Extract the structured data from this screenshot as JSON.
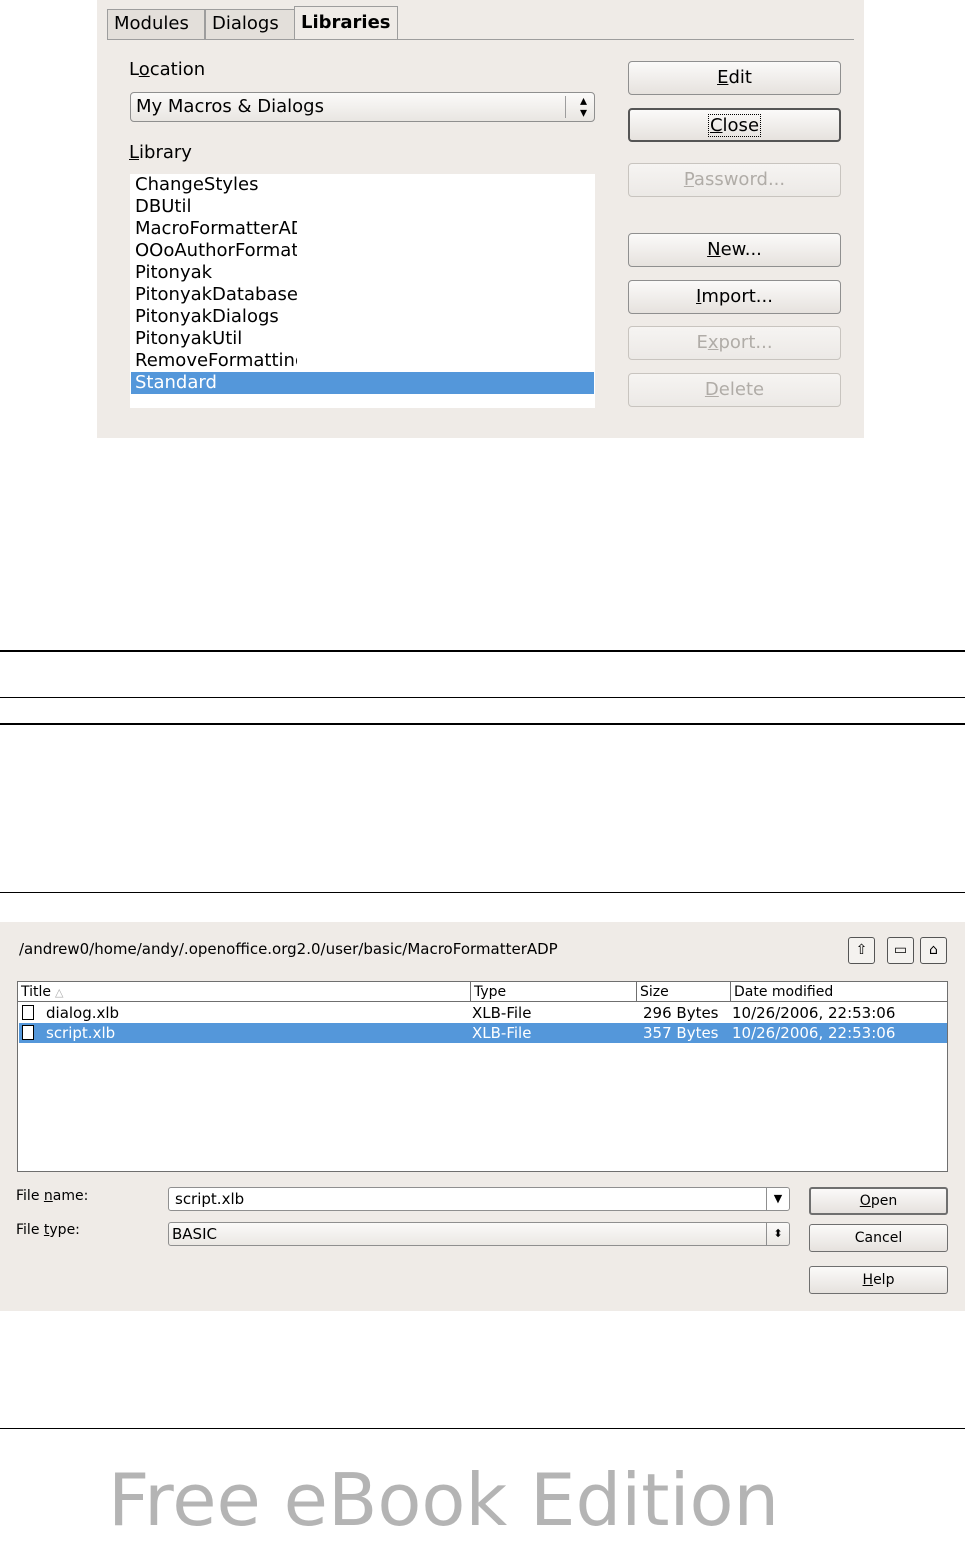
{
  "libraries_dialog": {
    "tabs": [
      {
        "label": "Modules",
        "active": false
      },
      {
        "label": "Dialogs",
        "active": false
      },
      {
        "label": "Libraries",
        "active": true
      }
    ],
    "location_label": "Location",
    "location_value": "My Macros & Dialogs",
    "library_label": "Library",
    "libraries": [
      "ChangeStyles",
      "DBUtil",
      "MacroFormatterADP",
      "OOoAuthorFormat",
      "Pitonyak",
      "PitonyakDatabase",
      "PitonyakDialogs",
      "PitonyakUtil",
      "RemoveFormatting",
      "Standard"
    ],
    "selected_library": "Standard",
    "buttons": {
      "edit": "Edit",
      "close": "Close",
      "password": "Password...",
      "new": "New...",
      "import": "Import...",
      "export": "Export...",
      "delete": "Delete"
    }
  },
  "file_dialog": {
    "path": "/andrew0/home/andy/.openoffice.org2.0/user/basic/MacroFormatterADP",
    "columns": {
      "title": "Title",
      "type": "Type",
      "size": "Size",
      "date": "Date modified"
    },
    "files": [
      {
        "name": "dialog.xlb",
        "type": "XLB-File",
        "size": "296 Bytes",
        "date": "10/26/2006, 22:53:06"
      },
      {
        "name": "script.xlb",
        "type": "XLB-File",
        "size": "357 Bytes",
        "date": "10/26/2006, 22:53:06"
      }
    ],
    "file_name_label": "File name:",
    "file_name_value": "script.xlb",
    "file_type_label": "File type:",
    "file_type_value": "BASIC",
    "buttons": {
      "open": "Open",
      "cancel": "Cancel",
      "help": "Help"
    }
  },
  "watermark": "Free eBook Edition",
  "colors": {
    "dialog_bg": "#efebe7",
    "selection": "#5497da",
    "watermark": "#b4b4b4"
  }
}
